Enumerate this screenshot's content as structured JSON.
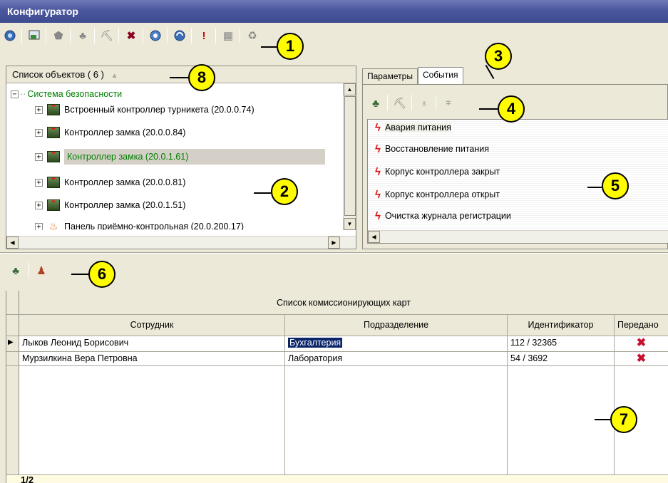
{
  "window": {
    "title": "Конфигуратор"
  },
  "callouts": [
    "1",
    "2",
    "3",
    "4",
    "5",
    "6",
    "7",
    "8"
  ],
  "object_list": {
    "header": "Список объектов ( 6 )",
    "sort_glyph": "▲",
    "root": "Система безопасности",
    "items": [
      "Встроенный контроллер турникета (20.0.0.74)",
      "Контроллер замка (20.0.0.84)",
      "Контроллер замка (20.0.1.61)",
      "Контроллер замка (20.0.0.81)",
      "Контроллер замка (20.0.1.51)",
      "Панель приёмно-контрольная (20.0.200.17)"
    ]
  },
  "tabs": [
    "Параметры",
    "События"
  ],
  "events": [
    "Авария питания",
    "Восстановление питания",
    "Корпус контроллера закрыт",
    "Корпус контроллера открыт",
    "Очистка журнала регистрации"
  ],
  "cards": {
    "title": "Список комиссионирующих карт",
    "columns": [
      "Сотрудник",
      "Подразделение",
      "Идентификатор",
      "Передано"
    ],
    "rows": [
      {
        "employee": "Лыков Леонид Борисович",
        "department": "Бухгалтерия",
        "id": "112 / 32365"
      },
      {
        "employee": "Мурзилкина Вера Петровна",
        "department": "Лаборатория",
        "id": "54 / 3692"
      }
    ],
    "pager": "1/2"
  },
  "colors": {
    "title_bar": "#4b579d",
    "callout": "#fffb00",
    "tree_root": "#008000",
    "selection": "#0a246a"
  }
}
